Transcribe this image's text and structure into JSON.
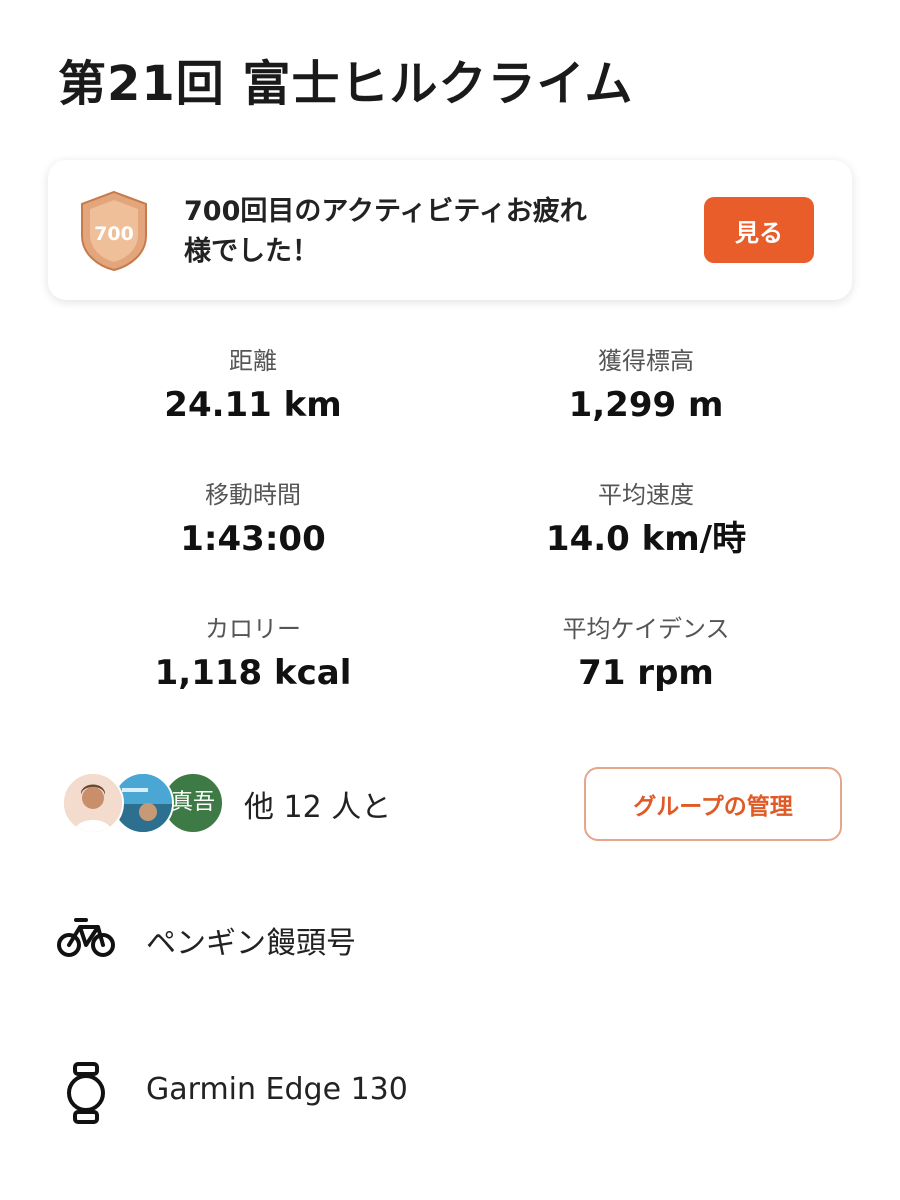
{
  "activity": {
    "title": "第21回 富士ヒルクライム"
  },
  "achievement": {
    "badge_number": "700",
    "message_line1": "700回目のアクティビティお疲れ",
    "message_line2": "様でした！",
    "view_label": "見る"
  },
  "stats": [
    {
      "label": "距離",
      "value": "24.11 km"
    },
    {
      "label": "獲得標高",
      "value": "1,299 m"
    },
    {
      "label": "移動時間",
      "value": "1:43:00"
    },
    {
      "label": "平均速度",
      "value": "14.0 km/時"
    },
    {
      "label": "カロリー",
      "value": "1,118 kcal"
    },
    {
      "label": "平均ケイデンス",
      "value": "71 rpm"
    }
  ],
  "group": {
    "avatar3_text": "真吾",
    "with_text": "他 12 人と",
    "manage_label": "グループの管理"
  },
  "gear": {
    "bike_name": "ペンギン饅頭号",
    "device_name": "Garmin Edge 130"
  },
  "colors": {
    "accent": "#e85d2a",
    "badge_bronze": "#d9895a"
  }
}
